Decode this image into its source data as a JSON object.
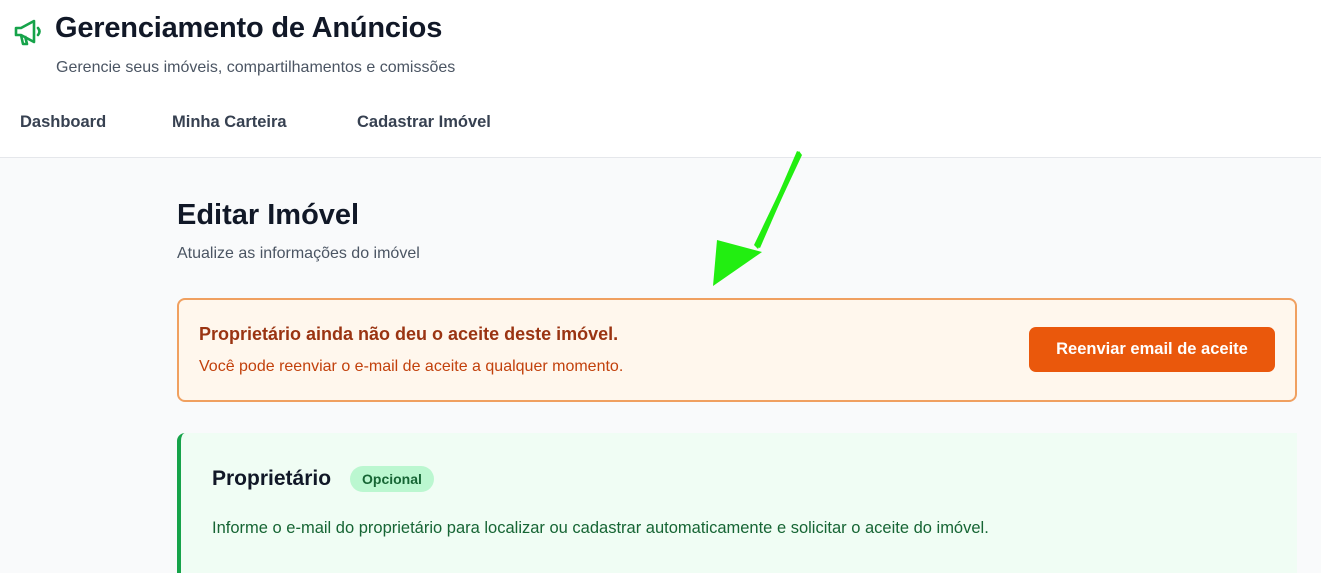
{
  "header": {
    "icon": "megaphone-icon",
    "title": "Gerenciamento de Anúncios",
    "subtitle": "Gerencie seus imóveis, compartilhamentos e comissões"
  },
  "nav": {
    "items": [
      {
        "label": "Dashboard"
      },
      {
        "label": "Minha Carteira"
      },
      {
        "label": "Cadastrar Imóvel"
      }
    ]
  },
  "page": {
    "title": "Editar Imóvel",
    "subtitle": "Atualize as informações do imóvel"
  },
  "alert": {
    "title": "Proprietário ainda não deu o aceite deste imóvel.",
    "text": "Você pode reenviar o e-mail de aceite a qualquer momento.",
    "button_label": "Reenviar email de aceite"
  },
  "owner_section": {
    "title": "Proprietário",
    "badge": "Opcional",
    "description": "Informe o e-mail do proprietário para localizar ou cadastrar automaticamente e solicitar o aceite do imóvel."
  },
  "colors": {
    "brand": "#16a34a",
    "alert_accent": "#ea580c",
    "annotation_arrow": "#22ee11"
  }
}
